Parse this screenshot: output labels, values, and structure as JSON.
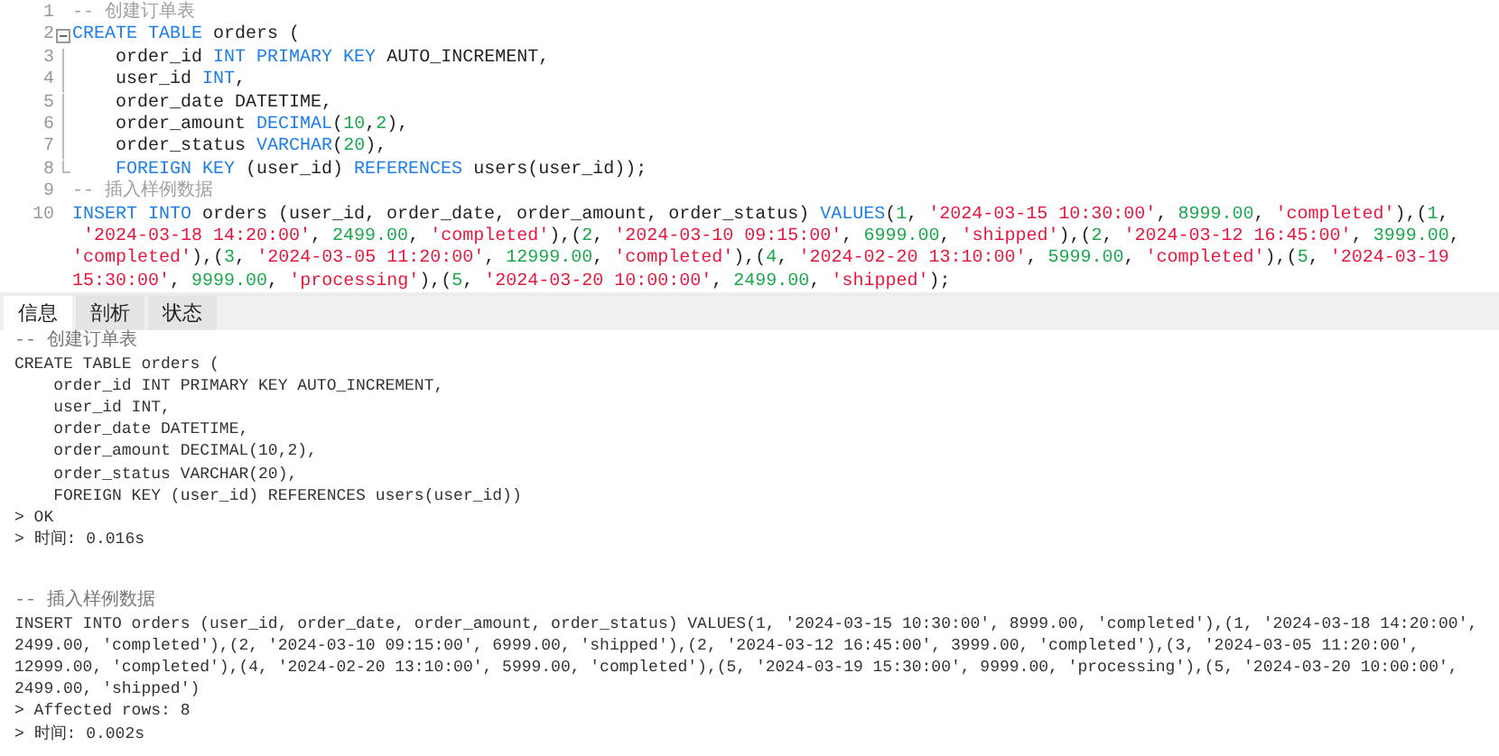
{
  "editor": {
    "lines": [
      {
        "number": "1",
        "rows": [
          {
            "tokens": [
              {
                "kind": "cmt",
                "text": "-- 创建订单表"
              }
            ]
          }
        ]
      },
      {
        "number": "2",
        "expanded": true,
        "rows": [
          {
            "tokens": [
              {
                "kind": "kw",
                "text": "CREATE "
              },
              {
                "kind": "kw",
                "text": "TABLE"
              },
              {
                "kind": "txt",
                "text": " orders ("
              }
            ]
          }
        ]
      },
      {
        "number": "3",
        "in_fold": true,
        "rows": [
          {
            "tokens": [
              {
                "kind": "txt",
                "text": "    order_id "
              },
              {
                "kind": "kw",
                "text": "INT "
              },
              {
                "kind": "kw",
                "text": "PRIMARY "
              },
              {
                "kind": "kw",
                "text": "KEY"
              },
              {
                "kind": "txt",
                "text": " AUTO_INCREMENT,"
              }
            ]
          }
        ]
      },
      {
        "number": "4",
        "in_fold": true,
        "rows": [
          {
            "tokens": [
              {
                "kind": "txt",
                "text": "    user_id "
              },
              {
                "kind": "kw",
                "text": "INT"
              },
              {
                "kind": "txt",
                "text": ","
              }
            ]
          }
        ]
      },
      {
        "number": "5",
        "in_fold": true,
        "rows": [
          {
            "tokens": [
              {
                "kind": "txt",
                "text": "    order_date DATETIME,"
              }
            ]
          }
        ]
      },
      {
        "number": "6",
        "in_fold": true,
        "rows": [
          {
            "tokens": [
              {
                "kind": "txt",
                "text": "    order_amount "
              },
              {
                "kind": "kw",
                "text": "DECIMAL"
              },
              {
                "kind": "txt",
                "text": "("
              },
              {
                "kind": "num",
                "text": "10"
              },
              {
                "kind": "txt",
                "text": ","
              },
              {
                "kind": "num",
                "text": "2"
              },
              {
                "kind": "txt",
                "text": "),"
              }
            ]
          }
        ]
      },
      {
        "number": "7",
        "in_fold": true,
        "rows": [
          {
            "tokens": [
              {
                "kind": "txt",
                "text": "    order_status "
              },
              {
                "kind": "kw",
                "text": "VARCHAR"
              },
              {
                "kind": "txt",
                "text": "("
              },
              {
                "kind": "num",
                "text": "20"
              },
              {
                "kind": "txt",
                "text": "),"
              }
            ]
          }
        ]
      },
      {
        "number": "8",
        "in_fold": true,
        "rows": [
          {
            "tokens": [
              {
                "kind": "kw",
                "text": "    FOREIGN "
              },
              {
                "kind": "kw",
                "text": "KEY"
              },
              {
                "kind": "txt",
                "text": " (user_id) "
              },
              {
                "kind": "kw",
                "text": "REFERENCES"
              },
              {
                "kind": "txt",
                "text": " users(user_id));"
              }
            ]
          }
        ]
      },
      {
        "number": "9",
        "rows": [
          {
            "tokens": [
              {
                "kind": "cmt",
                "text": "-- 插入样例数据"
              }
            ]
          }
        ]
      },
      {
        "number": "10",
        "rows": [
          {
            "tokens": [
              {
                "kind": "kw",
                "text": "INSERT "
              },
              {
                "kind": "kw",
                "text": "INTO"
              },
              {
                "kind": "txt",
                "text": " orders (user_id, order_date, order_amount, order_status) "
              },
              {
                "kind": "kw",
                "text": "VALUES"
              },
              {
                "kind": "txt",
                "text": "("
              },
              {
                "kind": "num",
                "text": "1"
              },
              {
                "kind": "txt",
                "text": ", "
              },
              {
                "kind": "str",
                "text": "'2024-03-15 10:30:00'"
              },
              {
                "kind": "txt",
                "text": ", "
              },
              {
                "kind": "num",
                "text": "8999.00"
              },
              {
                "kind": "txt",
                "text": ", "
              },
              {
                "kind": "str",
                "text": "'completed'"
              },
              {
                "kind": "txt",
                "text": "),("
              },
              {
                "kind": "num",
                "text": "1"
              },
              {
                "kind": "txt",
                "text": ","
              }
            ]
          },
          {
            "tokens": [
              {
                "kind": "str",
                "text": " '2024-03-18 14:20:00'"
              },
              {
                "kind": "txt",
                "text": ", "
              },
              {
                "kind": "num",
                "text": "2499.00"
              },
              {
                "kind": "txt",
                "text": ", "
              },
              {
                "kind": "str",
                "text": "'completed'"
              },
              {
                "kind": "txt",
                "text": "),("
              },
              {
                "kind": "num",
                "text": "2"
              },
              {
                "kind": "txt",
                "text": ", "
              },
              {
                "kind": "str",
                "text": "'2024-03-10 09:15:00'"
              },
              {
                "kind": "txt",
                "text": ", "
              },
              {
                "kind": "num",
                "text": "6999.00"
              },
              {
                "kind": "txt",
                "text": ", "
              },
              {
                "kind": "str",
                "text": "'shipped'"
              },
              {
                "kind": "txt",
                "text": "),("
              },
              {
                "kind": "num",
                "text": "2"
              },
              {
                "kind": "txt",
                "text": ", "
              },
              {
                "kind": "str",
                "text": "'2024-03-12 16:45:00'"
              },
              {
                "kind": "txt",
                "text": ", "
              },
              {
                "kind": "num",
                "text": "3999.00"
              },
              {
                "kind": "txt",
                "text": ","
              }
            ]
          },
          {
            "tokens": [
              {
                "kind": "str",
                "text": "'completed'"
              },
              {
                "kind": "txt",
                "text": "),("
              },
              {
                "kind": "num",
                "text": "3"
              },
              {
                "kind": "txt",
                "text": ", "
              },
              {
                "kind": "str",
                "text": "'2024-03-05 11:20:00'"
              },
              {
                "kind": "txt",
                "text": ", "
              },
              {
                "kind": "num",
                "text": "12999.00"
              },
              {
                "kind": "txt",
                "text": ", "
              },
              {
                "kind": "str",
                "text": "'completed'"
              },
              {
                "kind": "txt",
                "text": "),("
              },
              {
                "kind": "num",
                "text": "4"
              },
              {
                "kind": "txt",
                "text": ", "
              },
              {
                "kind": "str",
                "text": "'2024-02-20 13:10:00'"
              },
              {
                "kind": "txt",
                "text": ", "
              },
              {
                "kind": "num",
                "text": "5999.00"
              },
              {
                "kind": "txt",
                "text": ", "
              },
              {
                "kind": "str",
                "text": "'completed'"
              },
              {
                "kind": "txt",
                "text": "),("
              },
              {
                "kind": "num",
                "text": "5"
              },
              {
                "kind": "txt",
                "text": ", "
              },
              {
                "kind": "str",
                "text": "'2024-03-19"
              }
            ]
          },
          {
            "tokens": [
              {
                "kind": "str",
                "text": "15:30:00'"
              },
              {
                "kind": "txt",
                "text": ", "
              },
              {
                "kind": "num",
                "text": "9999.00"
              },
              {
                "kind": "txt",
                "text": ", "
              },
              {
                "kind": "str",
                "text": "'processing'"
              },
              {
                "kind": "txt",
                "text": "),("
              },
              {
                "kind": "num",
                "text": "5"
              },
              {
                "kind": "txt",
                "text": ", "
              },
              {
                "kind": "str",
                "text": "'2024-03-20 10:00:00'"
              },
              {
                "kind": "txt",
                "text": ", "
              },
              {
                "kind": "num",
                "text": "2499.00"
              },
              {
                "kind": "txt",
                "text": ", "
              },
              {
                "kind": "str",
                "text": "'shipped'"
              },
              {
                "kind": "txt",
                "text": ");"
              }
            ]
          }
        ]
      }
    ]
  },
  "tabs": [
    {
      "label": "信息",
      "selected": true
    },
    {
      "label": "剖析",
      "selected": false
    },
    {
      "label": "状态",
      "selected": false
    }
  ],
  "output": {
    "blocks": [
      {
        "lines": [
          {
            "kind": "comment",
            "text": "-- 创建订单表"
          },
          {
            "kind": "sql",
            "text": "CREATE TABLE orders ("
          },
          {
            "kind": "sql",
            "text": "    order_id INT PRIMARY KEY AUTO_INCREMENT,"
          },
          {
            "kind": "sql",
            "text": "    user_id INT,"
          },
          {
            "kind": "sql",
            "text": "    order_date DATETIME,"
          },
          {
            "kind": "sql",
            "text": "    order_amount DECIMAL(10,2),"
          },
          {
            "kind": "sql",
            "text": "    order_status VARCHAR(20),"
          },
          {
            "kind": "sql",
            "text": "    FOREIGN KEY (user_id) REFERENCES users(user_id))"
          },
          {
            "kind": "result",
            "text": "> OK"
          },
          {
            "kind": "result",
            "text": "> 时间: 0.016s"
          }
        ]
      },
      {
        "lines": [
          {
            "kind": "comment",
            "text": "-- 插入样例数据"
          },
          {
            "kind": "sql",
            "text": "INSERT INTO orders (user_id, order_date, order_amount, order_status) VALUES(1, '2024-03-15 10:30:00', 8999.00, 'completed'),(1, '2024-03-18 14:20:00',"
          },
          {
            "kind": "sql",
            "text": "2499.00, 'completed'),(2, '2024-03-10 09:15:00', 6999.00, 'shipped'),(2, '2024-03-12 16:45:00', 3999.00, 'completed'),(3, '2024-03-05 11:20:00',"
          },
          {
            "kind": "sql",
            "text": "12999.00, 'completed'),(4, '2024-02-20 13:10:00', 5999.00, 'completed'),(5, '2024-03-19 15:30:00', 9999.00, 'processing'),(5, '2024-03-20 10:00:00',"
          },
          {
            "kind": "sql",
            "text": "2499.00, 'shipped')"
          },
          {
            "kind": "result",
            "text": "> Affected rows: 8"
          },
          {
            "kind": "result",
            "text": "> 时间: 0.002s"
          }
        ]
      }
    ]
  }
}
